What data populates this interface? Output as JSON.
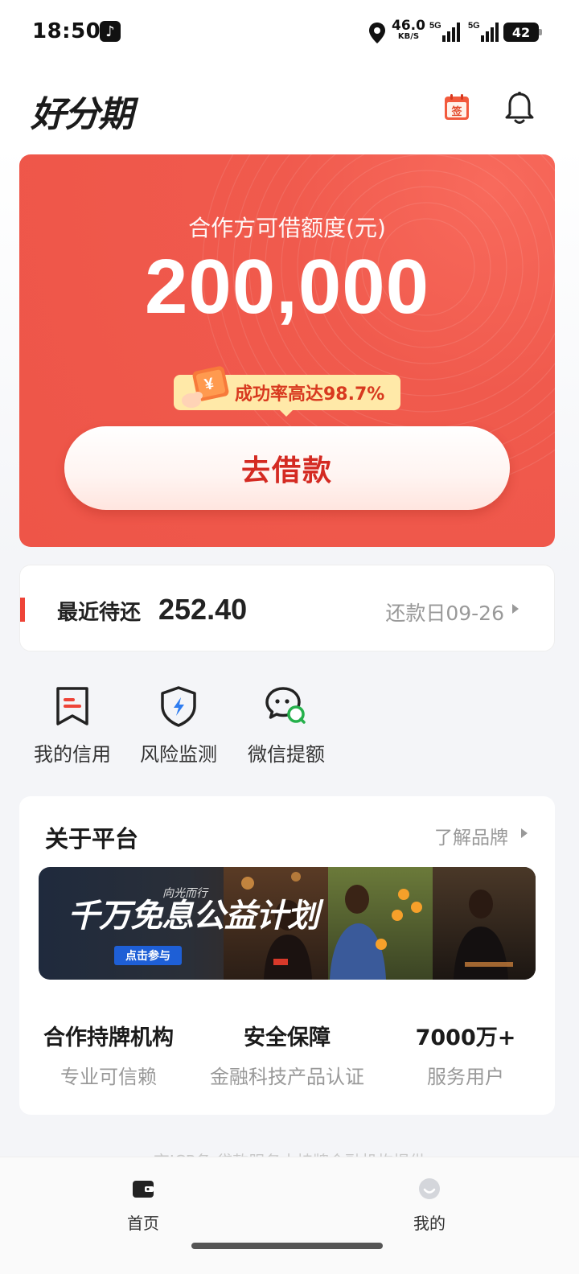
{
  "status_bar": {
    "time": "18:50",
    "net_speed_value": "46.0",
    "net_speed_unit": "KB/S",
    "signal_1_label": "5G",
    "signal_2_label": "5G",
    "battery": "42",
    "icons": [
      "tiktok-icon",
      "location-icon",
      "signal-5g-icon",
      "signal-5g-icon",
      "battery-icon"
    ]
  },
  "header": {
    "logo_text": "好分期",
    "icons": [
      "calendar-sign-icon",
      "bell-icon"
    ],
    "sign_glyph": "签"
  },
  "hero": {
    "label": "合作方可借额度(元)",
    "amount": "200,000",
    "rate_tag": "成功率高达98.7%",
    "ticket_glyph": "¥",
    "borrow_button": "去借款",
    "colors": {
      "background": "#ee5548",
      "button_text": "#d42a22",
      "tag_bg": "#ffe9a8"
    }
  },
  "repay": {
    "label": "最近待还",
    "amount": "252.40",
    "due_date": "还款日09-26"
  },
  "quick_actions": [
    {
      "label": "我的信用",
      "icon": "credit-bookmark-icon"
    },
    {
      "label": "风险监测",
      "icon": "shield-lightning-icon"
    },
    {
      "label": "微信提额",
      "icon": "wechat-icon"
    }
  ],
  "about": {
    "title": "关于平台",
    "more_link": "了解品牌",
    "banner": {
      "title": "千万免息公益计划",
      "subtitle": "向光而行",
      "button": "点击参与"
    },
    "stats": [
      {
        "title": "合作持牌机构",
        "subtitle": "专业可信赖"
      },
      {
        "title": "安全保障",
        "subtitle": "金融科技产品认证"
      },
      {
        "title": "7000万+",
        "subtitle": "服务用户"
      }
    ]
  },
  "footnote": "京ICP备·贷款服务由持牌金融机构提供",
  "tabbar": {
    "tabs": [
      {
        "label": "首页",
        "icon": "wallet-icon",
        "active": true
      },
      {
        "label": "我的",
        "icon": "avatar-icon",
        "active": false
      }
    ]
  }
}
